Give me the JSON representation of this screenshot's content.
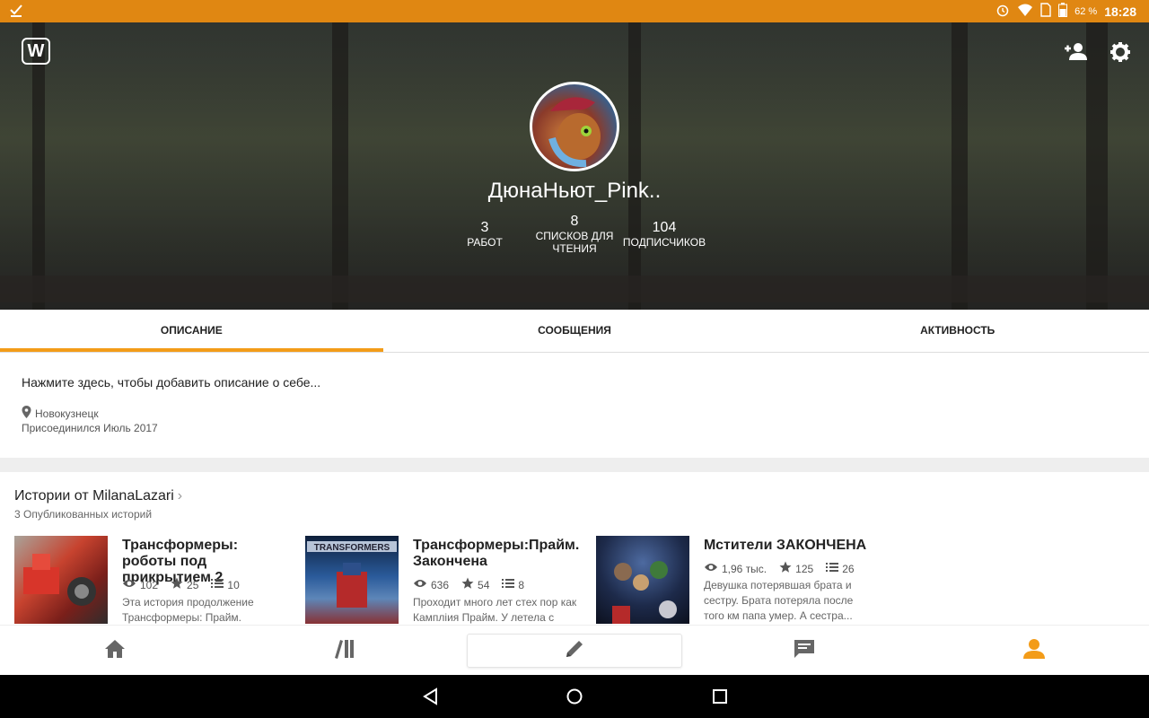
{
  "status_bar": {
    "battery_percent": "62 %",
    "time": "18:28"
  },
  "profile": {
    "username": "ДюнаНьют_Pink..",
    "stats": [
      {
        "value": "3",
        "label": "РАБОТ"
      },
      {
        "value": "8",
        "label": "СПИСКОВ ДЛЯ ЧТЕНИЯ"
      },
      {
        "value": "104",
        "label": "ПОДПИСЧИКОВ"
      }
    ]
  },
  "tabs": [
    {
      "label": "ОПИСАНИЕ",
      "active": true
    },
    {
      "label": "СООБЩЕНИЯ",
      "active": false
    },
    {
      "label": "АКТИВНОСТЬ",
      "active": false
    }
  ],
  "about": {
    "description_prompt": "Нажмите здесь, чтобы добавить описание о себе...",
    "location": "Новокузнецк",
    "joined": "Присоединился Июль 2017"
  },
  "stories": {
    "title": "Истории от MilanaLazari",
    "subtitle": "3 Опубликованных историй",
    "items": [
      {
        "title": "Трансформеры: роботы под прикрытием 2",
        "reads": "102",
        "votes": "25",
        "parts": "10",
        "description": "Эта история продолжение Трансформеры: Прайм.",
        "cover_color": "#b8332b"
      },
      {
        "title": "Трансформеры:Прайм. Закончена",
        "reads": "636",
        "votes": "54",
        "parts": "8",
        "description": "Проходит много лет стех пор как Кампліия Прайм. У летела с",
        "cover_color": "#1f4f8a"
      },
      {
        "title": "Мстители ЗАКОНЧЕНА",
        "reads": "1,96 тыс.",
        "votes": "125",
        "parts": "26",
        "description": "Девушка потерявшая брата и сестру. Брата потеряла после того км папа умер. А сестра...",
        "cover_color": "#1d2a4a"
      }
    ]
  },
  "colors": {
    "accent": "#f39c19",
    "status_bar": "#e08712"
  }
}
